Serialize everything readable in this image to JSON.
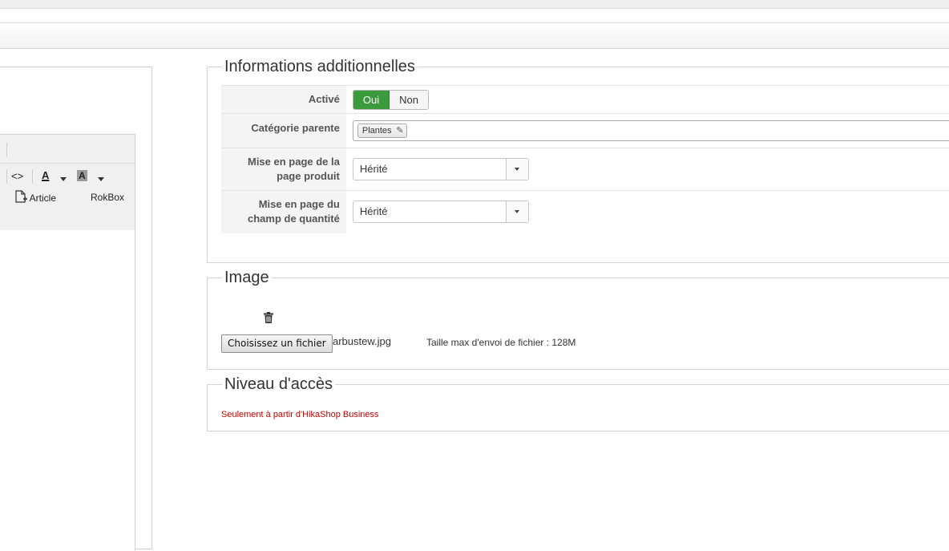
{
  "editor": {
    "toolbar": {
      "code_label": "<>",
      "font_color_label": "A",
      "bg_color_label": "A",
      "article_label": "Article",
      "rokbox_label": "RokBox"
    }
  },
  "additional_info": {
    "legend": "Informations additionnelles",
    "active": {
      "label": "Activé",
      "yes": "Oui",
      "no": "Non",
      "selected": "Oui"
    },
    "parent_category": {
      "label": "Catégorie parente",
      "value": "Plantes"
    },
    "product_layout": {
      "label_line1": "Mise en page de la",
      "label_line2": "page produit",
      "value": "Hérité"
    },
    "quantity_layout": {
      "label_line1": "Mise en page du",
      "label_line2": "champ de quantité",
      "value": "Hérité"
    }
  },
  "image": {
    "legend": "Image",
    "choose_button": "Choisissez un fichier",
    "filename": "arbustew.jpg",
    "max_size": "Taille max d'envoi de fichier : 128M"
  },
  "access": {
    "legend": "Niveau d'accès",
    "notice": "Seulement à partir d'HikaShop Business"
  },
  "colors": {
    "active_yes": "#3b9a3b",
    "notice": "#cc0000"
  }
}
